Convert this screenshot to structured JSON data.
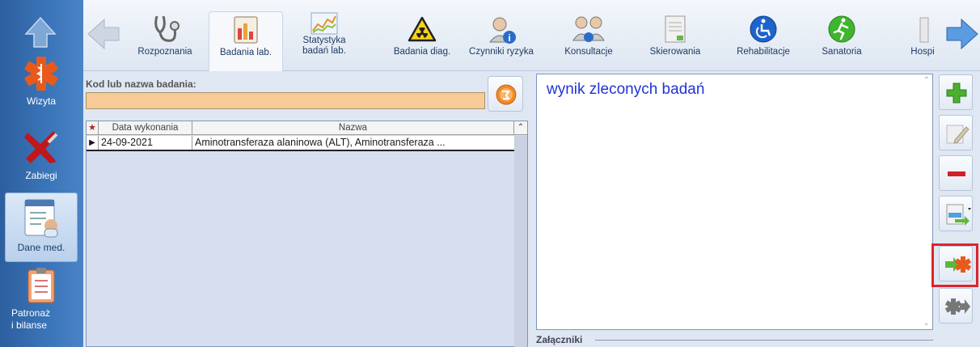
{
  "sidebar": {
    "items": [
      {
        "label": "Wizyta",
        "icon": "medical-star-icon"
      },
      {
        "label": "Zabiegi",
        "icon": "scalpel-icon"
      },
      {
        "label": "Dane med.",
        "icon": "medical-record-icon",
        "active": true
      },
      {
        "label": "Patronaż\ni bilanse",
        "icon": "clipboard-icon"
      }
    ]
  },
  "toolbar": {
    "tabs": [
      {
        "label": "Rozpoznania",
        "icon": "stethoscope-icon"
      },
      {
        "label": "Badania lab.",
        "icon": "lab-chart-icon",
        "active": true
      },
      {
        "label": "Statystyka\nbadań lab.",
        "icon": "stats-chart-icon"
      },
      {
        "label": "Badania diag.",
        "icon": "radiation-icon"
      },
      {
        "label": "Czynniki ryzyka",
        "icon": "user-info-icon"
      },
      {
        "label": "Konsultacje",
        "icon": "consult-users-icon"
      },
      {
        "label": "Skierowania",
        "icon": "document-icon"
      },
      {
        "label": "Rehabilitacje",
        "icon": "wheelchair-icon"
      },
      {
        "label": "Sanatoria",
        "icon": "runner-icon"
      },
      {
        "label": "Hospi",
        "icon": "hospital-icon"
      }
    ]
  },
  "search": {
    "label": "Kod lub nazwa badania:",
    "value": ""
  },
  "grid": {
    "columns": [
      "Data wykonania",
      "Nazwa"
    ],
    "rows": [
      {
        "date": "24-09-2021",
        "name": "Aminotransferaza alaninowa (ALT), Aminotransferaza ..."
      }
    ]
  },
  "result": {
    "text": "wynik zleconych badań"
  },
  "attachments": {
    "label": "Załączniki"
  },
  "colors": {
    "accent_blue": "#2133d6",
    "input_orange": "#f6cb97",
    "highlight_red": "#e0232d",
    "sidebar_blue": "#3a74b8"
  }
}
